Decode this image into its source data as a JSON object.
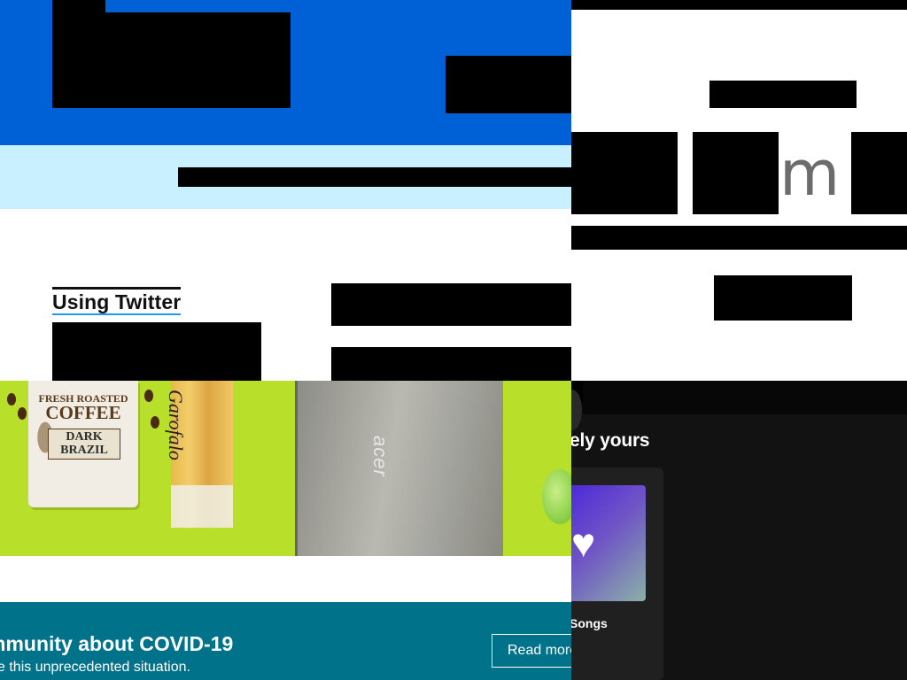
{
  "twitter_panel": {
    "using_twitter": "Using Twitter"
  },
  "search_panel": {
    "visible_letter": "m"
  },
  "shop_banner": {
    "coffee_brand_top": "FRESH ROASTED",
    "coffee_brand_main": "COFFEE",
    "coffee_variety": "DARK BRAZIL",
    "pasta_brand": "Garofalo",
    "laptop_brand": "acer",
    "covid_title": "mmunity about COVID-19",
    "covid_subtitle": "e this unprecedented situation.",
    "read_more": "Read more"
  },
  "music_panel": {
    "section_title": "ely yours",
    "card_label": "Songs"
  },
  "colors": {
    "twitter_blue_header": "#0060d6",
    "twitter_cyan_bar": "#c8f0ff",
    "banner_green": "#b8e02a",
    "covid_teal": "#007289",
    "music_bg": "#121212",
    "liked_songs_gradient_start": "#4d2ad8",
    "liked_songs_gradient_end": "#8bb1a7"
  }
}
